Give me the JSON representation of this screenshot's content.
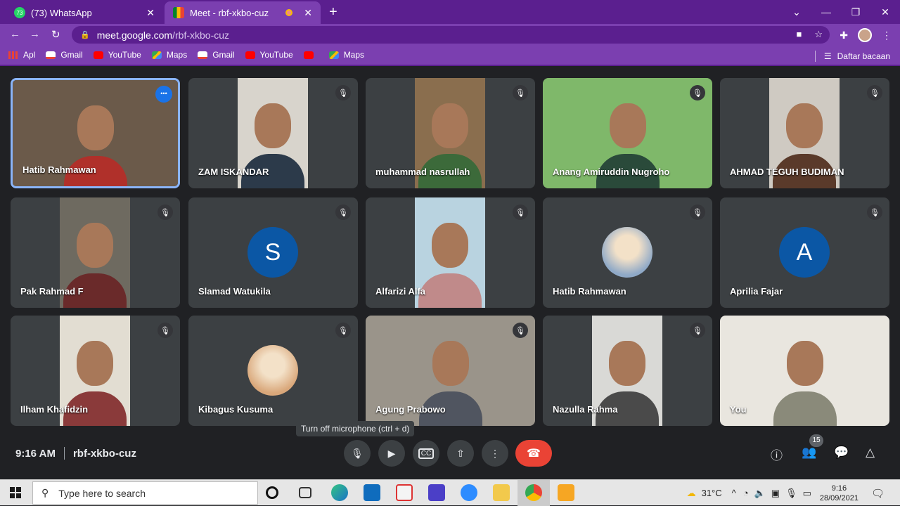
{
  "browser": {
    "tabs": [
      {
        "label": "(73) WhatsApp",
        "favicon": "whatsapp-icon",
        "badge": "73",
        "active": false
      },
      {
        "label": "Meet - rbf-xkbo-cuz",
        "favicon": "google-meet-icon",
        "active": true
      }
    ],
    "url_domain": "meet.google.com",
    "url_path": "/rbf-xkbo-cuz",
    "bookmarks": [
      {
        "label": "Apl",
        "icon": "apps-icon"
      },
      {
        "label": "Gmail",
        "icon": "gmail-icon"
      },
      {
        "label": "YouTube",
        "icon": "youtube-icon"
      },
      {
        "label": "Maps",
        "icon": "maps-icon"
      },
      {
        "label": "Gmail",
        "icon": "gmail-icon"
      },
      {
        "label": "YouTube",
        "icon": "youtube-icon"
      },
      {
        "label": "",
        "icon": "youtube-icon"
      },
      {
        "label": "Maps",
        "icon": "maps-icon"
      }
    ],
    "reading_list": "Daftar bacaan"
  },
  "participants": [
    {
      "name": "Hatib Rahmawan",
      "type": "video",
      "bg": "#6b5a4a",
      "shirt": "#b0302a",
      "active": true
    },
    {
      "name": "ZAM ISKANDAR",
      "type": "video",
      "bg": "#d8d4cc",
      "shirt": "#2c3a4a"
    },
    {
      "name": "muhammad nasrullah",
      "type": "video",
      "bg": "#8a6e4e",
      "shirt": "#3c6a3a"
    },
    {
      "name": "Anang Amiruddin Nugroho",
      "type": "video",
      "bg": "#7fb86a",
      "shirt": "#2a4a3a"
    },
    {
      "name": "AHMAD TEGUH BUDIMAN",
      "type": "video",
      "bg": "#cfcac2",
      "shirt": "#5a3a2a"
    },
    {
      "name": "Pak Rahmad F",
      "type": "video",
      "bg": "#6e6a60",
      "shirt": "#6a2a2a"
    },
    {
      "name": "Slamad Watukila",
      "type": "letter",
      "letter": "S"
    },
    {
      "name": "Alfarizi Alfa",
      "type": "video",
      "bg": "#b9d3e0",
      "shirt": "#c08a8a"
    },
    {
      "name": "Hatib Rahmawan",
      "type": "photo",
      "photo_color": "#8fa9c7"
    },
    {
      "name": "Aprilia Fajar",
      "type": "letter",
      "letter": "A"
    },
    {
      "name": "Ilham Khafidzin",
      "type": "video",
      "bg": "#e2ddd2",
      "shirt": "#8a3a3a"
    },
    {
      "name": "Kibagus Kusuma",
      "type": "photo",
      "photo_color": "#d9a77a"
    },
    {
      "name": "Agung Prabowo",
      "type": "video",
      "bg": "#9a948a",
      "shirt": "#505560"
    },
    {
      "name": "Nazulla Rahma",
      "type": "video",
      "bg": "#d9d9d6",
      "shirt": "#4a4a4a"
    },
    {
      "name": "You",
      "type": "video",
      "bg": "#e9e6df",
      "shirt": "#8a8a7a"
    }
  ],
  "tooltip": "Turn off microphone (ctrl + d)",
  "meeting": {
    "time": "9:16 AM",
    "code": "rbf-xkbo-cuz",
    "participant_count": "15"
  },
  "controls": [
    {
      "name": "mic-button",
      "icon": "microphone-icon"
    },
    {
      "name": "camera-button",
      "icon": "camera-icon"
    },
    {
      "name": "captions-button",
      "icon": "captions-icon"
    },
    {
      "name": "present-button",
      "icon": "present-screen-icon"
    },
    {
      "name": "more-options-button",
      "icon": "more-vert-icon"
    }
  ],
  "taskbar": {
    "search_placeholder": "Type here to search",
    "weather": "31°C",
    "time": "9:16",
    "date": "28/09/2021"
  }
}
